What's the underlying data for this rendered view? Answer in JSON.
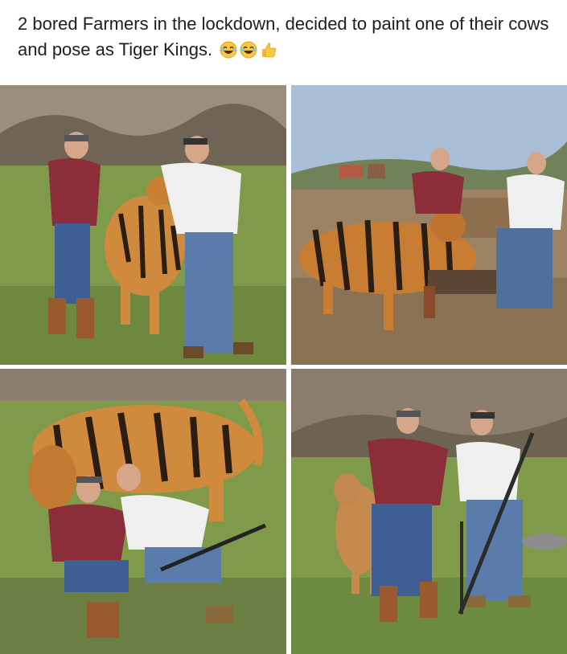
{
  "post": {
    "caption": "2 bored Farmers in the lockdown, decided to paint one of their cows and pose as Tiger Kings.",
    "reactions": [
      "laughing-emoji",
      "laughing-emoji",
      "thumbs-up-emoji"
    ]
  },
  "colors": {
    "grass": "#7e9a4a",
    "cow_orange": "#d08a3e",
    "stripe": "#2a1d14",
    "shirt_maroon": "#8b2e3a",
    "shirt_white": "#efefef",
    "jeans": "#4f6f9c",
    "sky": "#a9bfd8"
  }
}
